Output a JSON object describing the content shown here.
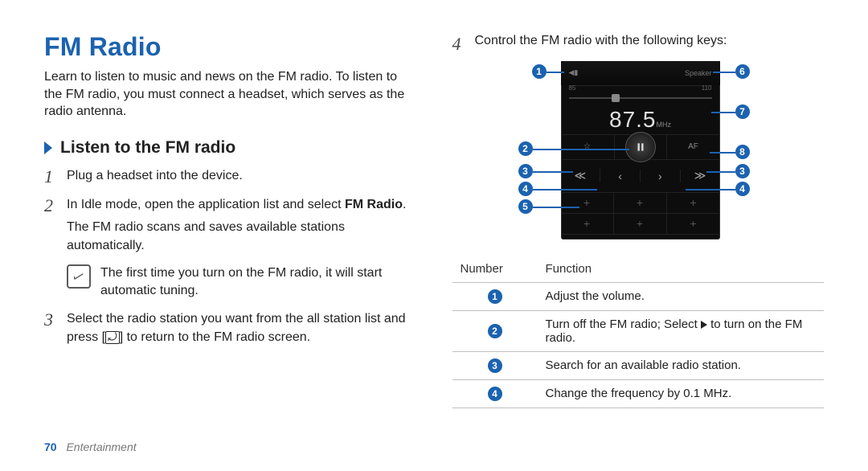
{
  "title": "FM Radio",
  "intro": "Learn to listen to music and news on the FM radio. To listen to the FM radio, you must connect a headset, which serves as the radio antenna.",
  "subhead": "Listen to the FM radio",
  "steps": {
    "s1": "Plug a headset into the device.",
    "s2_a": "In Idle mode, open the application list and select ",
    "s2_b": "FM Radio",
    "s2_c": ".",
    "s2_sub": "The FM radio scans and saves available stations automatically.",
    "note": "The first time you turn on the FM radio, it will start automatic tuning.",
    "s3_a": "Select the radio station you want from the all station list and press [",
    "s3_b": "] to return to the FM radio screen.",
    "s4": "Control the FM radio with the following keys:"
  },
  "phone": {
    "speaker_label": "Speaker",
    "slider_min": "85",
    "slider_max": "110",
    "freq_value": "87.5",
    "freq_unit": "MHz",
    "af_label": "AF"
  },
  "callouts": [
    "1",
    "2",
    "3",
    "4",
    "5",
    "6",
    "7",
    "8"
  ],
  "table": {
    "head_number": "Number",
    "head_function": "Function",
    "rows": [
      {
        "n": "1",
        "f": "Adjust the volume."
      },
      {
        "n": "2",
        "f_a": "Turn off the FM radio; Select ",
        "f_b": " to turn on the FM radio."
      },
      {
        "n": "3",
        "f": "Search for an available radio station."
      },
      {
        "n": "4",
        "f": "Change the frequency by 0.1 MHz."
      }
    ]
  },
  "footer": {
    "page": "70",
    "section": "Entertainment"
  }
}
